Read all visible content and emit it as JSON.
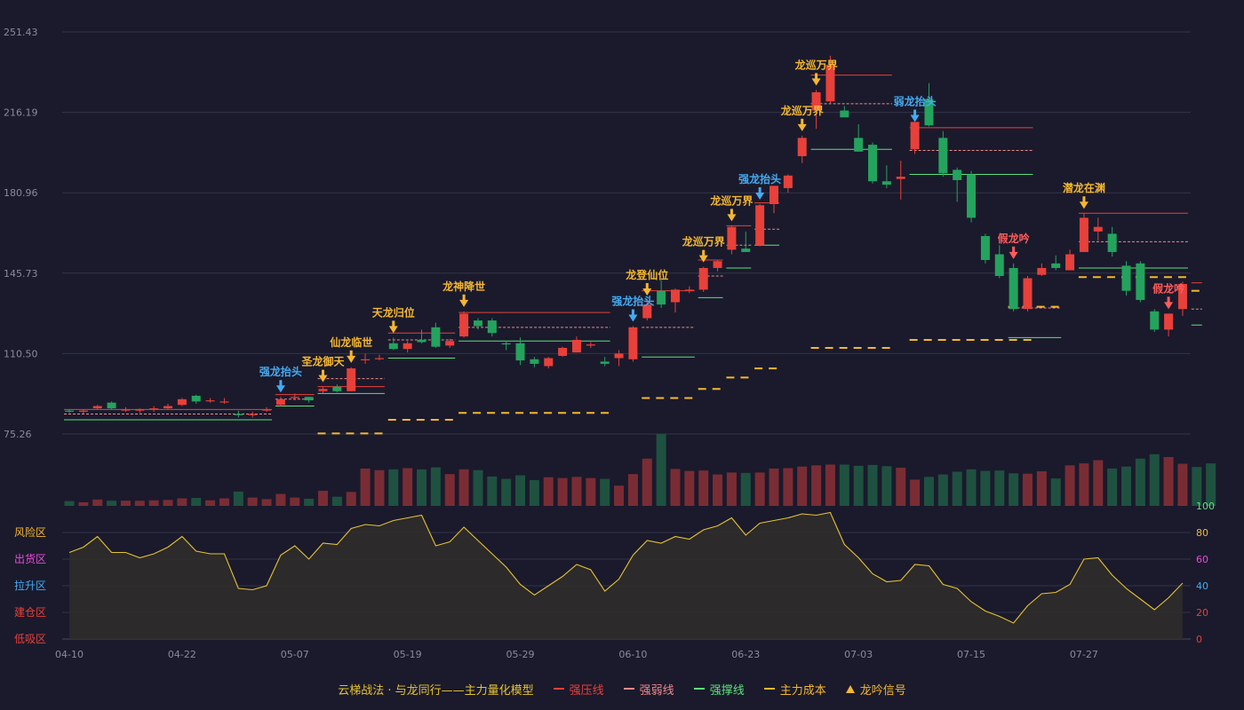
{
  "colors": {
    "background": "#1a1a2c",
    "grid": "#34344a",
    "axis_text": "#8a8a9a",
    "up": "#e8403a",
    "down": "#24a35e",
    "volume_up": "#7a2c34",
    "volume_down": "#1f5140",
    "resistance_line": "#e8403a",
    "weak_line": "#f08a8a",
    "support_line": "#5ee07a",
    "cost_line": "#f5b731",
    "signal_gold": "#f5b731",
    "signal_blue": "#45aaf2",
    "signal_red": "#ff5c5c",
    "osc_line": "#e6c231",
    "osc_fill": "#2f2c2a"
  },
  "chart_data": [
    {
      "type": "candlestick",
      "ylim": [
        75.26,
        251.43
      ],
      "y_ticks": [
        "251.43",
        "216.19",
        "180.96",
        "145.73",
        "110.50",
        "75.26"
      ],
      "x_ticks": [
        "04-10",
        "04-22",
        "05-07",
        "05-19",
        "05-29",
        "06-10",
        "06-23",
        "07-03",
        "07-15",
        "07-27"
      ],
      "x_tick_index": [
        0,
        8,
        16,
        24,
        32,
        40,
        48,
        56,
        64,
        72
      ],
      "candles": [
        [
          85.5,
          86.0,
          84.5,
          85.0
        ],
        [
          85.0,
          86.0,
          84.0,
          85.5
        ],
        [
          86.5,
          88.0,
          86.0,
          87.5
        ],
        [
          89.0,
          89.5,
          86.0,
          86.5
        ],
        [
          86.0,
          87.0,
          85.0,
          86.0
        ],
        [
          85.5,
          86.5,
          84.5,
          86.0
        ],
        [
          86.0,
          87.5,
          85.0,
          86.5
        ],
        [
          86.5,
          88.5,
          86.0,
          87.5
        ],
        [
          88.0,
          91.0,
          87.5,
          90.5
        ],
        [
          92.0,
          92.5,
          88.5,
          89.5
        ],
        [
          90.0,
          91.0,
          89.0,
          90.0
        ],
        [
          89.5,
          91.0,
          88.5,
          89.5
        ],
        [
          84.0,
          85.5,
          82.5,
          83.5
        ],
        [
          83.5,
          85.0,
          82.5,
          84.0
        ],
        [
          86.0,
          87.0,
          85.0,
          86.0
        ],
        [
          88.0,
          91.5,
          87.5,
          90.5
        ],
        [
          91.0,
          93.0,
          90.0,
          91.5
        ],
        [
          91.5,
          91.5,
          89.0,
          90.0
        ],
        [
          94.0,
          96.0,
          93.0,
          95.0
        ],
        [
          96.0,
          97.0,
          93.5,
          94.0
        ],
        [
          94.0,
          104.5,
          94.0,
          104.0
        ],
        [
          108.0,
          110.5,
          106.0,
          108.0
        ],
        [
          108.5,
          110.0,
          107.5,
          108.5
        ],
        [
          115.0,
          117.5,
          112.0,
          112.5
        ],
        [
          112.5,
          116.0,
          111.0,
          115.0
        ],
        [
          116.5,
          121.0,
          115.0,
          115.5
        ],
        [
          122.0,
          124.0,
          113.0,
          113.5
        ],
        [
          114.0,
          117.0,
          113.0,
          116.0
        ],
        [
          118.0,
          129.0,
          117.5,
          128.0
        ],
        [
          125.0,
          126.0,
          121.0,
          122.5
        ],
        [
          125.0,
          126.0,
          118.0,
          119.5
        ],
        [
          115.0,
          116.0,
          112.0,
          114.5
        ],
        [
          115.0,
          117.5,
          105.5,
          107.5
        ],
        [
          108.0,
          109.0,
          104.5,
          106.0
        ],
        [
          105.0,
          109.0,
          104.0,
          108.5
        ],
        [
          109.5,
          113.5,
          109.0,
          113.0
        ],
        [
          111.0,
          118.0,
          111.0,
          116.5
        ],
        [
          114.0,
          115.5,
          113.0,
          114.5
        ],
        [
          107.0,
          109.0,
          105.0,
          106.0
        ],
        [
          108.5,
          112.0,
          105.0,
          110.5
        ],
        [
          108.0,
          122.5,
          107.0,
          122.0
        ],
        [
          126.0,
          134.0,
          125.0,
          132.0
        ],
        [
          138.0,
          142.5,
          130.5,
          132.0
        ],
        [
          133.0,
          139.0,
          128.5,
          138.5
        ],
        [
          138.0,
          140.0,
          137.0,
          138.5
        ],
        [
          138.5,
          148.5,
          137.5,
          148.0
        ],
        [
          148.0,
          151.5,
          146.5,
          151.0
        ],
        [
          156.0,
          166.5,
          154.0,
          166.0
        ],
        [
          156.5,
          164.0,
          156.0,
          155.0
        ],
        [
          158.0,
          176.0,
          157.5,
          175.5
        ],
        [
          176.0,
          184.0,
          172.0,
          184.0
        ],
        [
          183.0,
          189.0,
          181.0,
          188.5
        ],
        [
          197.0,
          206.0,
          194.0,
          205.0
        ],
        [
          217.0,
          226.0,
          209.0,
          225.0
        ],
        [
          221.0,
          241.0,
          220.0,
          237.0
        ],
        [
          217.0,
          219.0,
          216.0,
          214.0
        ],
        [
          205.0,
          211.0,
          199.0,
          199.0
        ],
        [
          202.0,
          203.0,
          185.0,
          186.0
        ],
        [
          186.0,
          193.0,
          183.0,
          184.5
        ],
        [
          187.0,
          195.0,
          178.0,
          188.0
        ],
        [
          200.0,
          210.0,
          198.0,
          212.0
        ],
        [
          222.0,
          229.0,
          210.0,
          210.5
        ],
        [
          205.0,
          208.0,
          188.0,
          189.5
        ],
        [
          191.0,
          192.0,
          177.0,
          186.5
        ],
        [
          189.0,
          190.5,
          168.0,
          170.0
        ],
        [
          162.0,
          163.0,
          150.0,
          151.5
        ],
        [
          154.0,
          158.0,
          143.5,
          144.5
        ],
        [
          148.0,
          150.0,
          129.0,
          130.0
        ],
        [
          130.0,
          144.5,
          129.0,
          143.5
        ],
        [
          145.0,
          150.0,
          144.5,
          148.0
        ],
        [
          150.0,
          153.5,
          147.0,
          148.0
        ],
        [
          147.0,
          156.0,
          147.0,
          154.0
        ],
        [
          155.0,
          172.0,
          155.0,
          170.0
        ],
        [
          164.0,
          170.0,
          160.0,
          166.0
        ],
        [
          163.0,
          166.0,
          153.0,
          155.0
        ],
        [
          149.0,
          151.0,
          136.0,
          138.0
        ],
        [
          150.0,
          151.0,
          133.0,
          134.0
        ],
        [
          129.0,
          130.0,
          120.0,
          121.0
        ],
        [
          121.0,
          128.0,
          118.0,
          128.0
        ],
        [
          130.0,
          142.0,
          127.0,
          141.0
        ]
      ],
      "resistance_lines": [
        {
          "from": 0,
          "to": 14,
          "y": 86.0
        },
        {
          "from": 15,
          "to": 17,
          "y": 92.5
        },
        {
          "from": 18,
          "to": 22,
          "y": 96.0
        },
        {
          "from": 23,
          "to": 27,
          "y": 119.5
        },
        {
          "from": 28,
          "to": 38,
          "y": 128.5
        },
        {
          "from": 41,
          "to": 44,
          "y": 138.0
        },
        {
          "from": 45,
          "to": 46,
          "y": 151.5
        },
        {
          "from": 47,
          "to": 48,
          "y": 166.5
        },
        {
          "from": 49,
          "to": 50,
          "y": 176.5
        },
        {
          "from": 53,
          "to": 58,
          "y": 232.5
        },
        {
          "from": 60,
          "to": 68,
          "y": 209.5
        },
        {
          "from": 72,
          "to": 79,
          "y": 172.0
        },
        {
          "from": 80,
          "to": 80,
          "y": 141.5
        }
      ],
      "weak_lines": [
        {
          "from": 0,
          "to": 14,
          "y": 84.0
        },
        {
          "from": 15,
          "to": 17,
          "y": 90.5
        },
        {
          "from": 18,
          "to": 22,
          "y": 99.5
        },
        {
          "from": 23,
          "to": 27,
          "y": 116.5
        },
        {
          "from": 28,
          "to": 38,
          "y": 122.0
        },
        {
          "from": 41,
          "to": 44,
          "y": 122.0
        },
        {
          "from": 45,
          "to": 46,
          "y": 144.5
        },
        {
          "from": 47,
          "to": 48,
          "y": 158.0
        },
        {
          "from": 49,
          "to": 50,
          "y": 165.0
        },
        {
          "from": 53,
          "to": 58,
          "y": 220.0
        },
        {
          "from": 60,
          "to": 68,
          "y": 199.5
        },
        {
          "from": 67,
          "to": 70,
          "y": 130.5
        },
        {
          "from": 72,
          "to": 79,
          "y": 159.5
        },
        {
          "from": 80,
          "to": 80,
          "y": 130.0
        }
      ],
      "support_lines": [
        {
          "from": 0,
          "to": 14,
          "y": 81.5
        },
        {
          "from": 15,
          "to": 17,
          "y": 87.5
        },
        {
          "from": 18,
          "to": 22,
          "y": 93.0
        },
        {
          "from": 23,
          "to": 27,
          "y": 108.5
        },
        {
          "from": 28,
          "to": 38,
          "y": 116.0
        },
        {
          "from": 41,
          "to": 44,
          "y": 109.0
        },
        {
          "from": 45,
          "to": 46,
          "y": 135.0
        },
        {
          "from": 47,
          "to": 48,
          "y": 148.0
        },
        {
          "from": 49,
          "to": 50,
          "y": 158.0
        },
        {
          "from": 53,
          "to": 58,
          "y": 200.0
        },
        {
          "from": 60,
          "to": 68,
          "y": 189.0
        },
        {
          "from": 67,
          "to": 70,
          "y": 117.5
        },
        {
          "from": 72,
          "to": 79,
          "y": 148.0
        },
        {
          "from": 80,
          "to": 80,
          "y": 123.0
        }
      ],
      "cost_lines": [
        {
          "from": 18,
          "to": 22,
          "y": 75.5
        },
        {
          "from": 23,
          "to": 27,
          "y": 81.5
        },
        {
          "from": 28,
          "to": 38,
          "y": 84.5
        },
        {
          "from": 41,
          "to": 44,
          "y": 91.0
        },
        {
          "from": 45,
          "to": 46,
          "y": 95.0
        },
        {
          "from": 47,
          "to": 48,
          "y": 100.0
        },
        {
          "from": 49,
          "to": 50,
          "y": 104.0
        },
        {
          "from": 53,
          "to": 58,
          "y": 113.0
        },
        {
          "from": 60,
          "to": 68,
          "y": 116.5
        },
        {
          "from": 67,
          "to": 70,
          "y": 131.0
        },
        {
          "from": 72,
          "to": 79,
          "y": 144.0
        },
        {
          "from": 80,
          "to": 80,
          "y": 138.0
        }
      ],
      "signals": [
        {
          "index": 15,
          "label": "强龙抬头",
          "kind": "blue"
        },
        {
          "index": 18,
          "label": "圣龙御天",
          "kind": "gold"
        },
        {
          "index": 20,
          "label": "仙龙临世",
          "kind": "gold"
        },
        {
          "index": 23,
          "label": "天龙归位",
          "kind": "gold"
        },
        {
          "index": 28,
          "label": "龙神降世",
          "kind": "gold"
        },
        {
          "index": 40,
          "label": "强龙抬头",
          "kind": "blue"
        },
        {
          "index": 41,
          "label": "龙登仙位",
          "kind": "gold"
        },
        {
          "index": 45,
          "label": "龙巡万界",
          "kind": "gold"
        },
        {
          "index": 47,
          "label": "龙巡万界",
          "kind": "gold"
        },
        {
          "index": 49,
          "label": "强龙抬头",
          "kind": "blue"
        },
        {
          "index": 52,
          "label": "龙巡万界",
          "kind": "gold"
        },
        {
          "index": 53,
          "label": "龙巡万界",
          "kind": "gold"
        },
        {
          "index": 60,
          "label": "弱龙抬头",
          "kind": "blue"
        },
        {
          "index": 67,
          "label": "假龙吟",
          "kind": "red"
        },
        {
          "index": 72,
          "label": "潜龙在渊",
          "kind": "gold"
        },
        {
          "index": 78,
          "label": "假龙吟",
          "kind": "red"
        },
        {
          "index": 80,
          "label": "",
          "kind": "gold"
        }
      ]
    },
    {
      "type": "bar",
      "series_name": "volume",
      "values": [
        12,
        9,
        16,
        13,
        13,
        13,
        14,
        15,
        19,
        20,
        14,
        19,
        36,
        21,
        17,
        30,
        21,
        18,
        38,
        23,
        35,
        94,
        90,
        92,
        95,
        92,
        97,
        80,
        92,
        90,
        74,
        68,
        77,
        65,
        72,
        70,
        73,
        70,
        68,
        51,
        80,
        119,
        181,
        93,
        88,
        89,
        79,
        84,
        83,
        84,
        94,
        95,
        99,
        102,
        104,
        104,
        101,
        103,
        100,
        96,
        66,
        73,
        79,
        86,
        92,
        88,
        89,
        82,
        81,
        87,
        69,
        102,
        107,
        115,
        94,
        99,
        119,
        130,
        123,
        106,
        98,
        107
      ]
    },
    {
      "type": "line",
      "series_name": "oscillator",
      "ylim": [
        0,
        100
      ],
      "y_ticks": [
        "0",
        "20",
        "40",
        "60",
        "80",
        "100"
      ],
      "zone_labels": [
        {
          "label": "风险区",
          "y": 80,
          "color": "#f5b731"
        },
        {
          "label": "出货区",
          "y": 60,
          "color": "#e84bd8"
        },
        {
          "label": "拉升区",
          "y": 40,
          "color": "#45aaf2"
        },
        {
          "label": "建仓区",
          "y": 20,
          "color": "#e8403a"
        },
        {
          "label": "低吸区",
          "y": 0,
          "color": "#e8403a"
        }
      ],
      "values": [
        65,
        69,
        77,
        65,
        65,
        61,
        64,
        69,
        77,
        66,
        64,
        64,
        38,
        37,
        40,
        63,
        70,
        60,
        72,
        71,
        83,
        86,
        85,
        89,
        91,
        93,
        70,
        73,
        84,
        74,
        64,
        54,
        41,
        33,
        40,
        47,
        56,
        52,
        36,
        45,
        63,
        74,
        72,
        77,
        75,
        82,
        85,
        91,
        78,
        87,
        89,
        91,
        94,
        93,
        95,
        71,
        61,
        49,
        43,
        44,
        56,
        55,
        41,
        38,
        28,
        21,
        17,
        12,
        25,
        34,
        35,
        41,
        60,
        61,
        48,
        38,
        30,
        22,
        31,
        42
      ]
    }
  ],
  "legend": {
    "title": "云梯战法 · 与龙同行——主力量化模型",
    "items": [
      {
        "label": "强压线",
        "kind": "resistance"
      },
      {
        "label": "强弱线",
        "kind": "weak"
      },
      {
        "label": "强撑线",
        "kind": "support"
      },
      {
        "label": "主力成本",
        "kind": "cost"
      },
      {
        "label": "龙吟信号",
        "kind": "signal"
      }
    ]
  }
}
